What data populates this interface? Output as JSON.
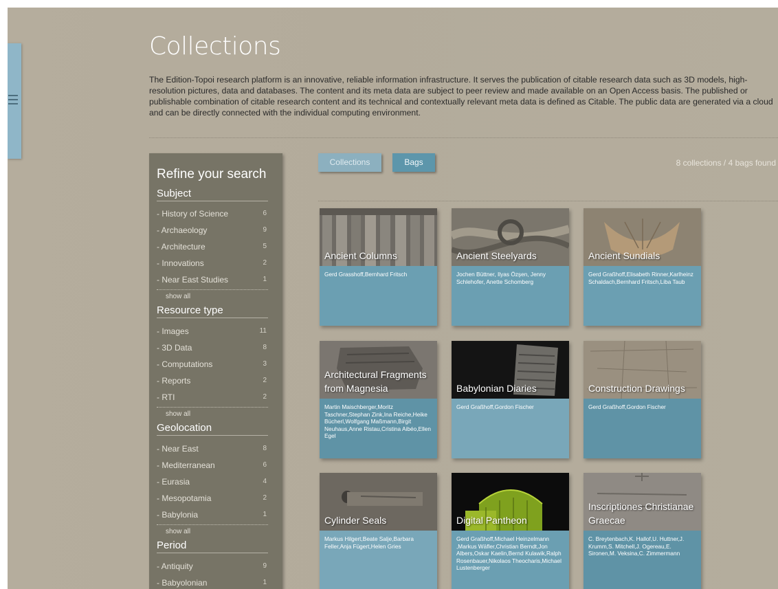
{
  "page": {
    "title": "Collections",
    "intro": "The Edition-Topoi research platform is an innovative, reliable information infrastructure. It serves the publication of citable research data such as 3D models, high-resolution pictures, data and databases. The content and its meta data are subject to peer review and made available on an Open Access basis. The published or publishable combination of citable research content and its technical and contextually relevant meta data is defined as Citable. The public data are generated via a cloud and can be directly connected with the individual computing environment."
  },
  "menu": {
    "icon": "hamburger-menu-icon"
  },
  "sidebar": {
    "title": "Refine your search",
    "show_all": "show all",
    "facets": [
      {
        "title": "Subject",
        "items": [
          {
            "label": "History of Science",
            "count": "6"
          },
          {
            "label": "Archaeology",
            "count": "9"
          },
          {
            "label": "Architecture",
            "count": "5"
          },
          {
            "label": "Innovations",
            "count": "2"
          },
          {
            "label": "Near East Studies",
            "count": "1"
          }
        ]
      },
      {
        "title": "Resource type",
        "items": [
          {
            "label": "Images",
            "count": "11"
          },
          {
            "label": "3D Data",
            "count": "8"
          },
          {
            "label": "Computations",
            "count": "3"
          },
          {
            "label": "Reports",
            "count": "2"
          },
          {
            "label": "RTI",
            "count": "2"
          }
        ]
      },
      {
        "title": "Geolocation",
        "items": [
          {
            "label": "Near East",
            "count": "8"
          },
          {
            "label": "Mediterranean",
            "count": "6"
          },
          {
            "label": "Eurasia",
            "count": "4"
          },
          {
            "label": "Mesopotamia",
            "count": "2"
          },
          {
            "label": "Babylonia",
            "count": "1"
          }
        ]
      },
      {
        "title": "Period",
        "items": [
          {
            "label": "Antiquity",
            "count": "9"
          },
          {
            "label": "Babyolonian",
            "count": "1"
          }
        ]
      }
    ]
  },
  "toolbar": {
    "collections_label": "Collections",
    "bags_label": "Bags",
    "results": "8 collections / 4 bags found"
  },
  "cards": [
    {
      "title": "Ancient Columns",
      "authors": "Gerd Grasshoff,Bernhard Fritsch"
    },
    {
      "title": "Ancient Steelyards",
      "authors": "Jochen Büttner, Ilyas Özşen, Jenny Schlehofer, Anette Schomberg"
    },
    {
      "title": "Ancient Sundials",
      "authors": "Gerd Graßhoff,Elisabeth Rinner,Karlheinz Schaldach,Bernhard Fritsch,Liba Taub"
    },
    {
      "title": "Architectural Fragments from Magnesia",
      "authors": "Martin Maischberger,Moritz Taschner,Stephan Zink,Ina Reiche,Heike Bücherl,Wolfgang Maßmann,Birgit Neuhaus,Anne Ristau,Cristina Aibéo,Ellen Egel"
    },
    {
      "title": "Babylonian Diaries",
      "authors": "Gerd Graßhoff,Gordon Fischer"
    },
    {
      "title": "Construction Drawings",
      "authors": "Gerd Graßhoff,Gordon Fischer"
    },
    {
      "title": "Cylinder Seals",
      "authors": "Markus Hilgert,Beate Salje,Barbara Feller,Anja Fügert,Helen Gries"
    },
    {
      "title": "Digital Pantheon",
      "authors": "Gerd Graßhoff,Michael Heinzelmann ,Markus Wäfler,Christian Berndt,Jon Albers,Oskar Kaelin,Bernd Kulawik,Ralph Rosenbauer,Nikolaos Theocharis,Michael Lustenberger"
    },
    {
      "title": "Inscriptiones Christianae Graecae",
      "authors": "C. Breytenbach,K. Hallof,U. Huttner,J. Krumm,S. Mitchell,J. Ogereau,E. Sironen,M. Veksina,C. Zimmermann"
    }
  ]
}
